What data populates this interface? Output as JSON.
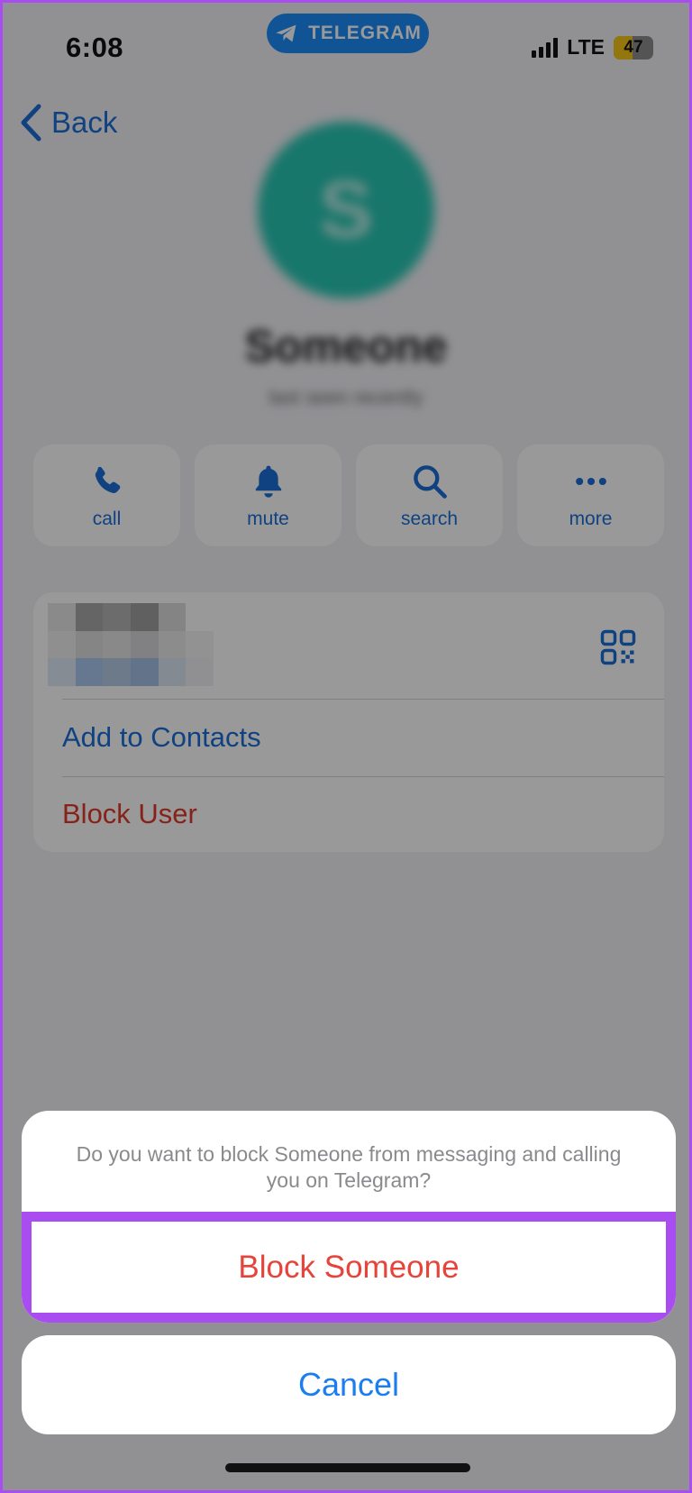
{
  "status_bar": {
    "time": "6:08",
    "app_pill": "TELEGRAM",
    "network": "LTE",
    "battery": "47",
    "battery_level_percent": 47
  },
  "nav": {
    "back_label": "Back"
  },
  "profile": {
    "avatar_initial": "S",
    "name": "Someone",
    "subtitle": "last seen recently"
  },
  "actions": [
    {
      "label": "call",
      "icon": "phone-icon"
    },
    {
      "label": "mute",
      "icon": "bell-icon"
    },
    {
      "label": "search",
      "icon": "search-icon"
    },
    {
      "label": "more",
      "icon": "more-icon"
    }
  ],
  "info_card": {
    "qr_icon": "qr-code-icon",
    "add_to_contacts": "Add to Contacts",
    "block_user": "Block User"
  },
  "action_sheet": {
    "message": "Do you want to block Someone from messaging and calling you on Telegram?",
    "confirm_label": "Block Someone",
    "cancel_label": "Cancel"
  },
  "colors": {
    "accent": "#1b6fd8",
    "destructive": "#e8433a",
    "highlight_border": "#a94cf0",
    "telegram_blue": "#1d8cf8"
  }
}
